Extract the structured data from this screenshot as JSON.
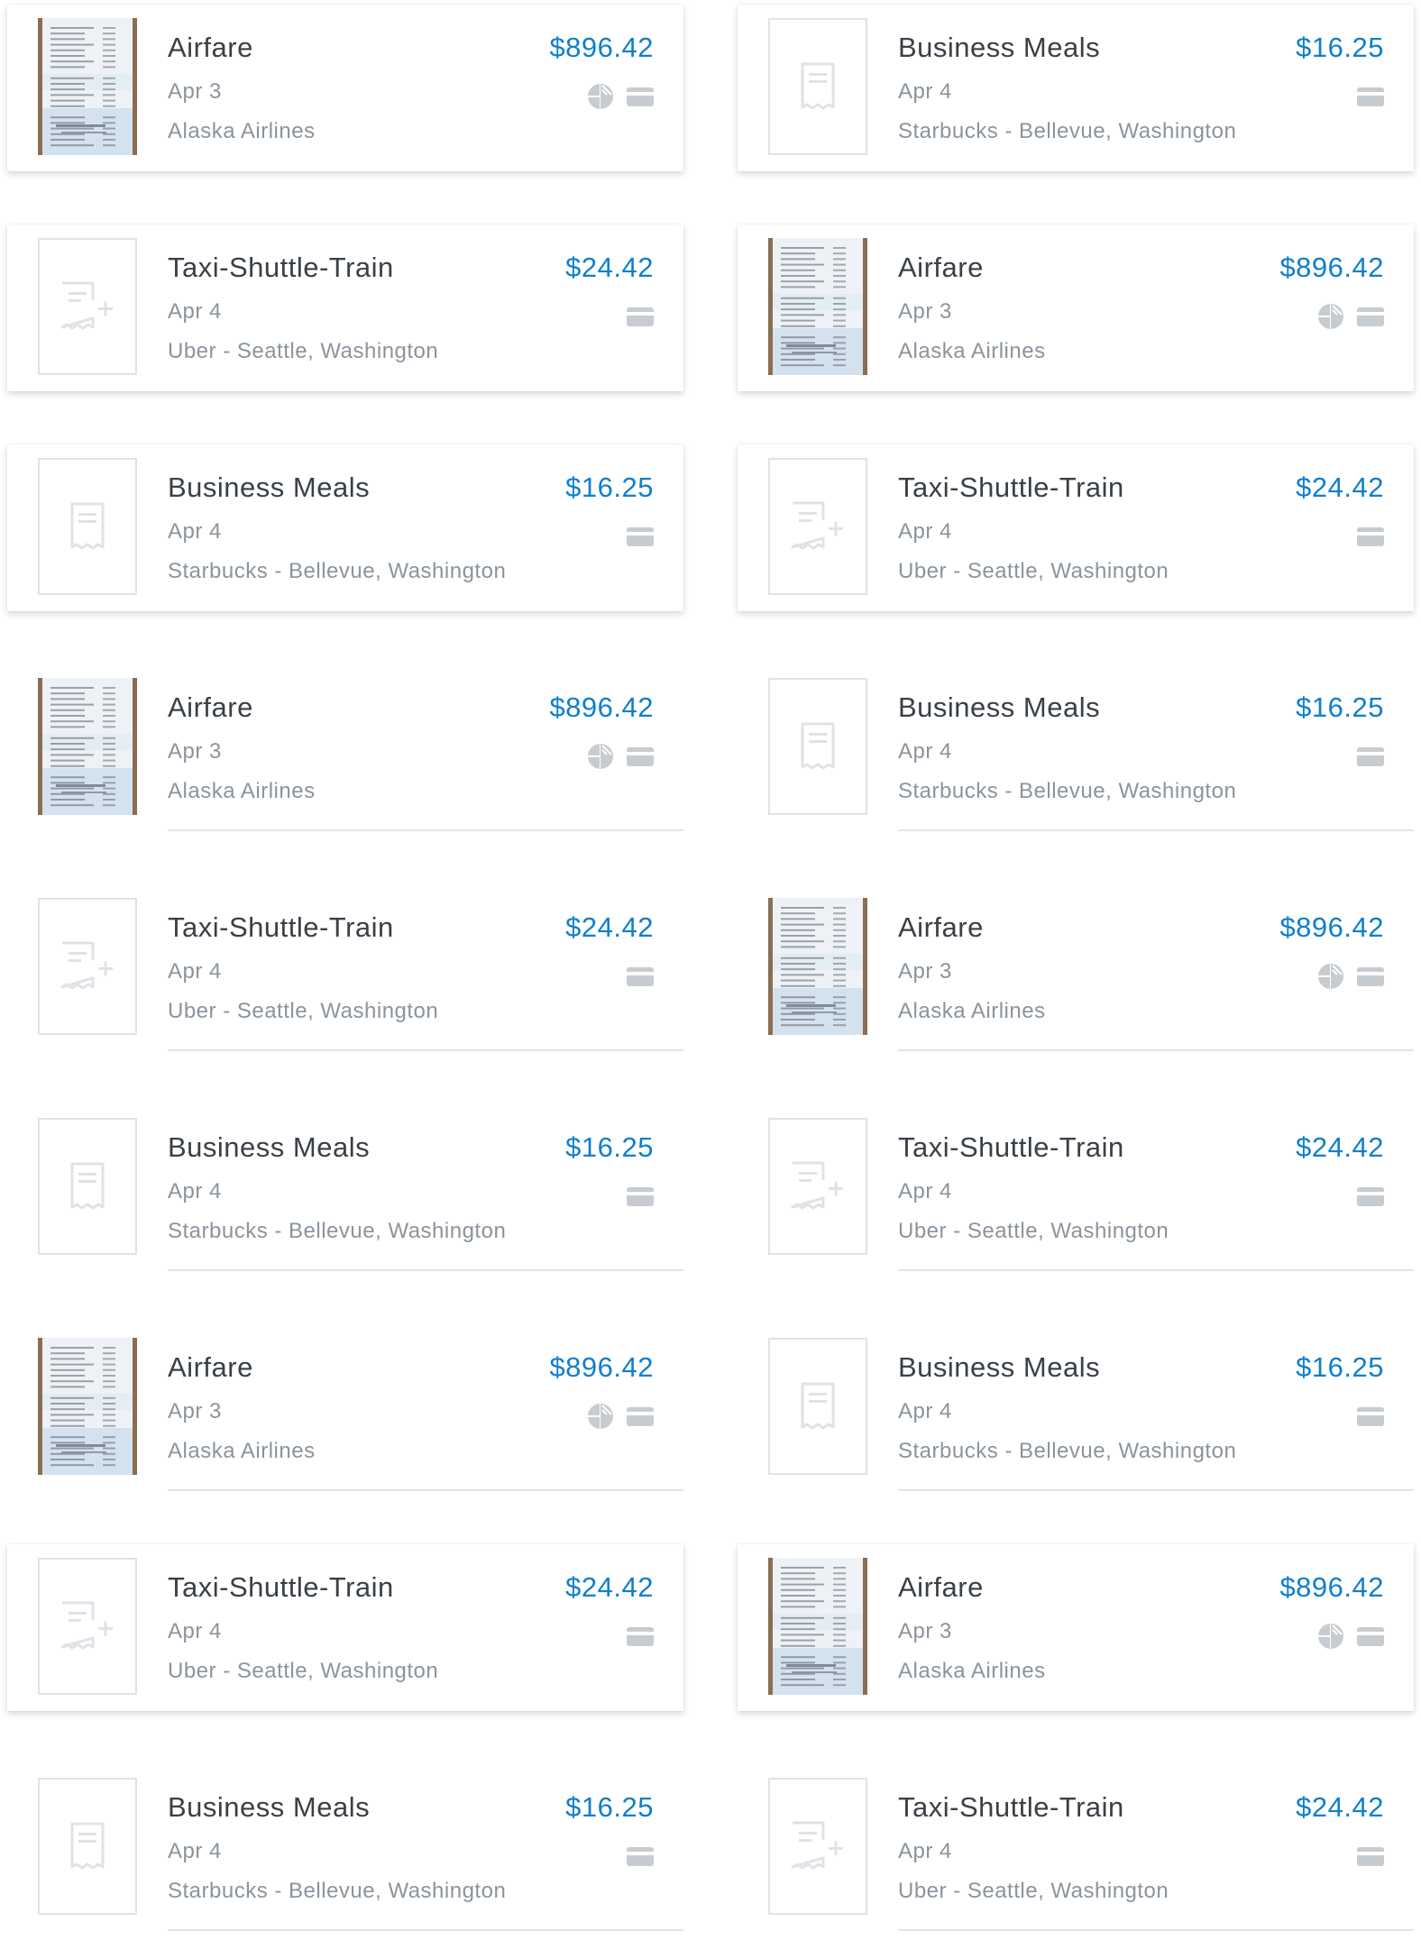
{
  "colors": {
    "amount": "#0f7fcc",
    "category": "#3a4047",
    "secondary_text": "#8b949d",
    "icon": "#c7ccd1",
    "separator": "#e2e5e8"
  },
  "expenses": [
    {
      "category": "Airfare",
      "date": "Apr 3",
      "merchant": "Alaska Airlines",
      "amount": "$896.42",
      "receipt": "photo",
      "icons": [
        "split-icon",
        "card-icon"
      ]
    },
    {
      "category": "Business Meals",
      "date": "Apr 4",
      "merchant": "Starbucks - Bellevue, Washington",
      "amount": "$16.25",
      "receipt": "blank",
      "icons": [
        "card-icon"
      ]
    },
    {
      "category": "Taxi-Shuttle-Train",
      "date": "Apr 4",
      "merchant": "Uber - Seattle, Washington",
      "amount": "$24.42",
      "receipt": "add",
      "icons": [
        "card-icon"
      ]
    },
    {
      "category": "Airfare",
      "date": "Apr 3",
      "merchant": "Alaska Airlines",
      "amount": "$896.42",
      "receipt": "photo",
      "icons": [
        "split-icon",
        "card-icon"
      ]
    },
    {
      "category": "Business Meals",
      "date": "Apr 4",
      "merchant": "Starbucks - Bellevue, Washington",
      "amount": "$16.25",
      "receipt": "blank",
      "icons": [
        "card-icon"
      ]
    },
    {
      "category": "Taxi-Shuttle-Train",
      "date": "Apr 4",
      "merchant": "Uber - Seattle, Washington",
      "amount": "$24.42",
      "receipt": "add",
      "icons": [
        "card-icon"
      ]
    },
    {
      "category": "Airfare",
      "date": "Apr 3",
      "merchant": "Alaska Airlines",
      "amount": "$896.42",
      "receipt": "photo",
      "icons": [
        "split-icon",
        "card-icon"
      ]
    },
    {
      "category": "Business Meals",
      "date": "Apr 4",
      "merchant": "Starbucks - Bellevue, Washington",
      "amount": "$16.25",
      "receipt": "blank",
      "icons": [
        "card-icon"
      ]
    },
    {
      "category": "Taxi-Shuttle-Train",
      "date": "Apr 4",
      "merchant": "Uber - Seattle, Washington",
      "amount": "$24.42",
      "receipt": "add",
      "icons": [
        "card-icon"
      ]
    },
    {
      "category": "Airfare",
      "date": "Apr 3",
      "merchant": "Alaska Airlines",
      "amount": "$896.42",
      "receipt": "photo",
      "icons": [
        "split-icon",
        "card-icon"
      ]
    },
    {
      "category": "Business Meals",
      "date": "Apr 4",
      "merchant": "Starbucks - Bellevue, Washington",
      "amount": "$16.25",
      "receipt": "blank",
      "icons": [
        "card-icon"
      ]
    },
    {
      "category": "Taxi-Shuttle-Train",
      "date": "Apr 4",
      "merchant": "Uber - Seattle, Washington",
      "amount": "$24.42",
      "receipt": "add",
      "icons": [
        "card-icon"
      ]
    },
    {
      "category": "Airfare",
      "date": "Apr 3",
      "merchant": "Alaska Airlines",
      "amount": "$896.42",
      "receipt": "photo",
      "icons": [
        "split-icon",
        "card-icon"
      ]
    },
    {
      "category": "Business Meals",
      "date": "Apr 4",
      "merchant": "Starbucks - Bellevue, Washington",
      "amount": "$16.25",
      "receipt": "blank",
      "icons": [
        "card-icon"
      ]
    },
    {
      "category": "Taxi-Shuttle-Train",
      "date": "Apr 4",
      "merchant": "Uber - Seattle, Washington",
      "amount": "$24.42",
      "receipt": "add",
      "icons": [
        "card-icon"
      ]
    },
    {
      "category": "Airfare",
      "date": "Apr 3",
      "merchant": "Alaska Airlines",
      "amount": "$896.42",
      "receipt": "photo",
      "icons": [
        "split-icon",
        "card-icon"
      ]
    },
    {
      "category": "Business Meals",
      "date": "Apr 4",
      "merchant": "Starbucks - Bellevue, Washington",
      "amount": "$16.25",
      "receipt": "blank",
      "icons": [
        "card-icon"
      ]
    },
    {
      "category": "Taxi-Shuttle-Train",
      "date": "Apr 4",
      "merchant": "Uber - Seattle, Washington",
      "amount": "$24.42",
      "receipt": "add",
      "icons": [
        "card-icon"
      ]
    }
  ]
}
